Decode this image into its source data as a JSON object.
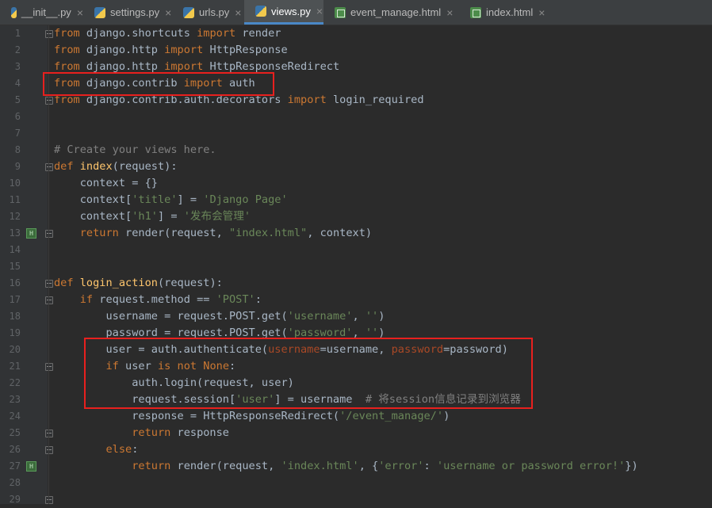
{
  "tabs": [
    {
      "label": "__init__.py",
      "icon": "python-file-icon",
      "active": false
    },
    {
      "label": "settings.py",
      "icon": "python-file-icon",
      "active": false
    },
    {
      "label": "urls.py",
      "icon": "python-file-icon",
      "active": false
    },
    {
      "label": "views.py",
      "icon": "python-file-icon",
      "active": true
    },
    {
      "label": "event_manage.html",
      "icon": "html-file-icon",
      "active": false
    },
    {
      "label": "index.html",
      "icon": "html-file-icon",
      "active": false
    }
  ],
  "line_numbers": [
    "1",
    "2",
    "3",
    "4",
    "5",
    "6",
    "7",
    "8",
    "9",
    "10",
    "11",
    "12",
    "13",
    "14",
    "15",
    "16",
    "17",
    "18",
    "19",
    "20",
    "21",
    "22",
    "23",
    "24",
    "25",
    "26",
    "27",
    "28",
    "29"
  ],
  "code_lines": [
    "from django.shortcuts import render",
    "from django.http import HttpResponse",
    "from django.http import HttpResponseRedirect",
    "from django.contrib import auth",
    "from django.contrib.auth.decorators import login_required",
    "",
    "",
    "# Create your views here.",
    "def index(request):",
    "    context = {}",
    "    context['title'] = 'Django Page'",
    "    context['h1'] = '发布会管理'",
    "    return render(request, \"index.html\", context)",
    "",
    "",
    "def login_action(request):",
    "    if request.method == 'POST':",
    "        username = request.POST.get('username', '')",
    "        password = request.POST.get('password', '')",
    "        user = auth.authenticate(username=username, password=password)",
    "        if user is not None:",
    "            auth.login(request, user)",
    "            request.session['user'] = username  # 将session信息记录到浏览器",
    "            response = HttpResponseRedirect('/event_manage/')",
    "            return response",
    "        else:",
    "            return render(request, 'index.html', {'error': 'username or password error!'})",
    "",
    ""
  ],
  "gutter_marker_label": "H",
  "colors": {
    "background": "#2b2b2b",
    "keyword": "#cc7832",
    "string": "#6a8759",
    "function": "#ffc66d",
    "comment": "#808080",
    "highlight_box": "#e8201e"
  }
}
